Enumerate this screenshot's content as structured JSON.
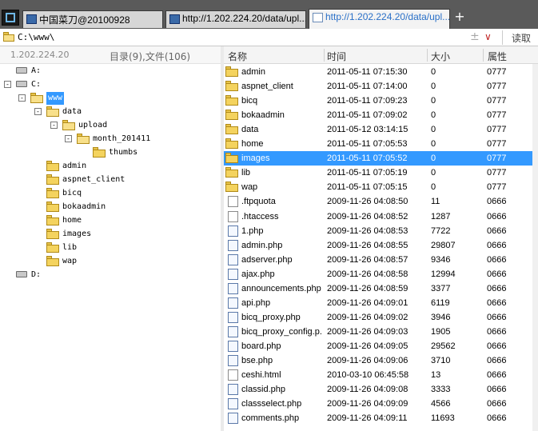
{
  "tabs": [
    {
      "label": "中国菜刀@20100928"
    },
    {
      "label": "http://1.202.224.20/data/upl..."
    },
    {
      "label": "http://1.202.224.20/data/upl..."
    }
  ],
  "newtab_label": "+",
  "address": {
    "path": "C:\\www\\",
    "plus": "±",
    "arrow": "∨",
    "read_label": "读取"
  },
  "status": {
    "ip": "1.202.224.20",
    "counts": "目录(9),文件(106)"
  },
  "tree": [
    {
      "label": "A:",
      "kind": "drive"
    },
    {
      "label": "C:",
      "kind": "drive",
      "box": "-"
    },
    {
      "label": "www",
      "kind": "folder",
      "box": "-",
      "selected": true
    },
    {
      "label": "data",
      "kind": "folder",
      "box": "-"
    },
    {
      "label": "upload",
      "kind": "folder",
      "box": "-"
    },
    {
      "label": "month_201411",
      "kind": "folder",
      "box": "-"
    },
    {
      "label": "thumbs",
      "kind": "folder"
    },
    {
      "label": "admin",
      "kind": "folder"
    },
    {
      "label": "aspnet_client",
      "kind": "folder"
    },
    {
      "label": "bicq",
      "kind": "folder"
    },
    {
      "label": "bokaadmin",
      "kind": "folder"
    },
    {
      "label": "home",
      "kind": "folder"
    },
    {
      "label": "images",
      "kind": "folder"
    },
    {
      "label": "lib",
      "kind": "folder"
    },
    {
      "label": "wap",
      "kind": "folder"
    },
    {
      "label": "D:",
      "kind": "drive"
    }
  ],
  "columns": {
    "name": "名称",
    "time": "时间",
    "size": "大小",
    "attr": "属性"
  },
  "files": [
    {
      "name": "admin",
      "time": "2011-05-11 07:15:30",
      "size": "0",
      "attr": "0777",
      "type": "folder"
    },
    {
      "name": "aspnet_client",
      "time": "2011-05-11 07:14:00",
      "size": "0",
      "attr": "0777",
      "type": "folder"
    },
    {
      "name": "bicq",
      "time": "2011-05-11 07:09:23",
      "size": "0",
      "attr": "0777",
      "type": "folder"
    },
    {
      "name": "bokaadmin",
      "time": "2011-05-11 07:09:02",
      "size": "0",
      "attr": "0777",
      "type": "folder"
    },
    {
      "name": "data",
      "time": "2011-05-12 03:14:15",
      "size": "0",
      "attr": "0777",
      "type": "folder"
    },
    {
      "name": "home",
      "time": "2011-05-11 07:05:53",
      "size": "0",
      "attr": "0777",
      "type": "folder"
    },
    {
      "name": "images",
      "time": "2011-05-11 07:05:52",
      "size": "0",
      "attr": "0777",
      "type": "folder",
      "selected": true
    },
    {
      "name": "lib",
      "time": "2011-05-11 07:05:19",
      "size": "0",
      "attr": "0777",
      "type": "folder"
    },
    {
      "name": "wap",
      "time": "2011-05-11 07:05:15",
      "size": "0",
      "attr": "0777",
      "type": "folder"
    },
    {
      "name": ".ftpquota",
      "time": "2009-11-26 04:08:50",
      "size": "11",
      "attr": "0666",
      "type": "file"
    },
    {
      "name": ".htaccess",
      "time": "2009-11-26 04:08:52",
      "size": "1287",
      "attr": "0666",
      "type": "file"
    },
    {
      "name": "1.php",
      "time": "2009-11-26 04:08:53",
      "size": "7722",
      "attr": "0666",
      "type": "php"
    },
    {
      "name": "admin.php",
      "time": "2009-11-26 04:08:55",
      "size": "29807",
      "attr": "0666",
      "type": "php"
    },
    {
      "name": "adserver.php",
      "time": "2009-11-26 04:08:57",
      "size": "9346",
      "attr": "0666",
      "type": "php"
    },
    {
      "name": "ajax.php",
      "time": "2009-11-26 04:08:58",
      "size": "12994",
      "attr": "0666",
      "type": "php"
    },
    {
      "name": "announcements.php",
      "time": "2009-11-26 04:08:59",
      "size": "3377",
      "attr": "0666",
      "type": "php"
    },
    {
      "name": "api.php",
      "time": "2009-11-26 04:09:01",
      "size": "6119",
      "attr": "0666",
      "type": "php"
    },
    {
      "name": "bicq_proxy.php",
      "time": "2009-11-26 04:09:02",
      "size": "3946",
      "attr": "0666",
      "type": "php"
    },
    {
      "name": "bicq_proxy_config.p...",
      "time": "2009-11-26 04:09:03",
      "size": "1905",
      "attr": "0666",
      "type": "php"
    },
    {
      "name": "board.php",
      "time": "2009-11-26 04:09:05",
      "size": "29562",
      "attr": "0666",
      "type": "php"
    },
    {
      "name": "bse.php",
      "time": "2009-11-26 04:09:06",
      "size": "3710",
      "attr": "0666",
      "type": "php"
    },
    {
      "name": "ceshi.html",
      "time": "2010-03-10 06:45:58",
      "size": "13",
      "attr": "0666",
      "type": "file"
    },
    {
      "name": "classid.php",
      "time": "2009-11-26 04:09:08",
      "size": "3333",
      "attr": "0666",
      "type": "php"
    },
    {
      "name": "classselect.php",
      "time": "2009-11-26 04:09:09",
      "size": "4566",
      "attr": "0666",
      "type": "php"
    },
    {
      "name": "comments.php",
      "time": "2009-11-26 04:09:11",
      "size": "11693",
      "attr": "0666",
      "type": "php"
    }
  ]
}
